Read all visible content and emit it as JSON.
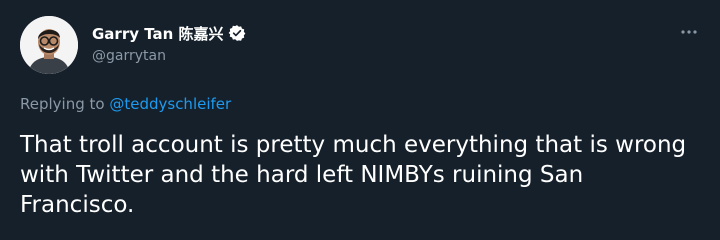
{
  "tweet": {
    "author": {
      "display_name": "Garry Tan 陈嘉兴",
      "handle": "@garrytan",
      "verified": true
    },
    "reply": {
      "prefix": "Replying to ",
      "mention": "@teddyschleifer"
    },
    "text": "That troll account is pretty much everything that is wrong with Twitter and the hard left NIMBYs ruining San Francisco."
  },
  "icons": {
    "verified": "verified-badge-icon",
    "more": "more-options-icon"
  },
  "colors": {
    "background": "#15202b",
    "primary_text": "#ffffff",
    "secondary_text": "#8b98a5",
    "accent": "#1d9bf0"
  }
}
